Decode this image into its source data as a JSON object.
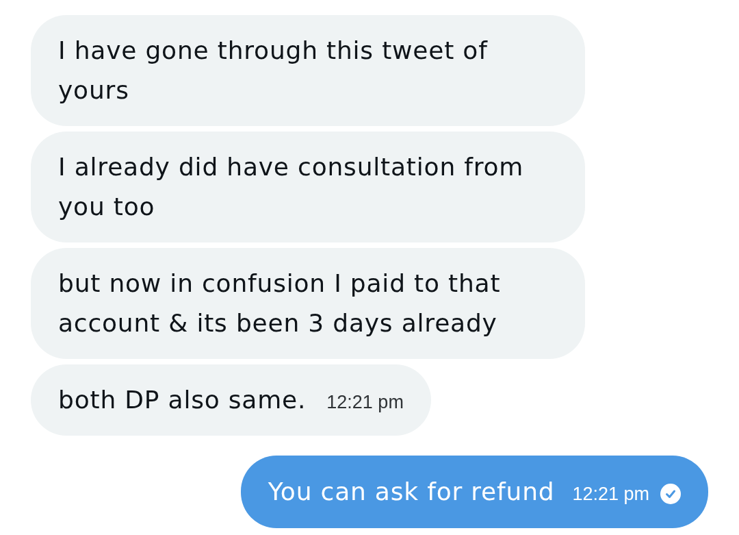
{
  "messages": [
    {
      "kind": "received",
      "text": "I have gone through this tweet of yours"
    },
    {
      "kind": "received",
      "text": "I already did have consultation from you too"
    },
    {
      "kind": "received",
      "text": "but now in confusion I paid to that account & its been 3 days already"
    },
    {
      "kind": "received",
      "text": "both DP also same.",
      "time": "12:21 pm"
    },
    {
      "kind": "sent",
      "text": "You can ask for refund",
      "time": "12:21 pm",
      "read": true
    }
  ]
}
